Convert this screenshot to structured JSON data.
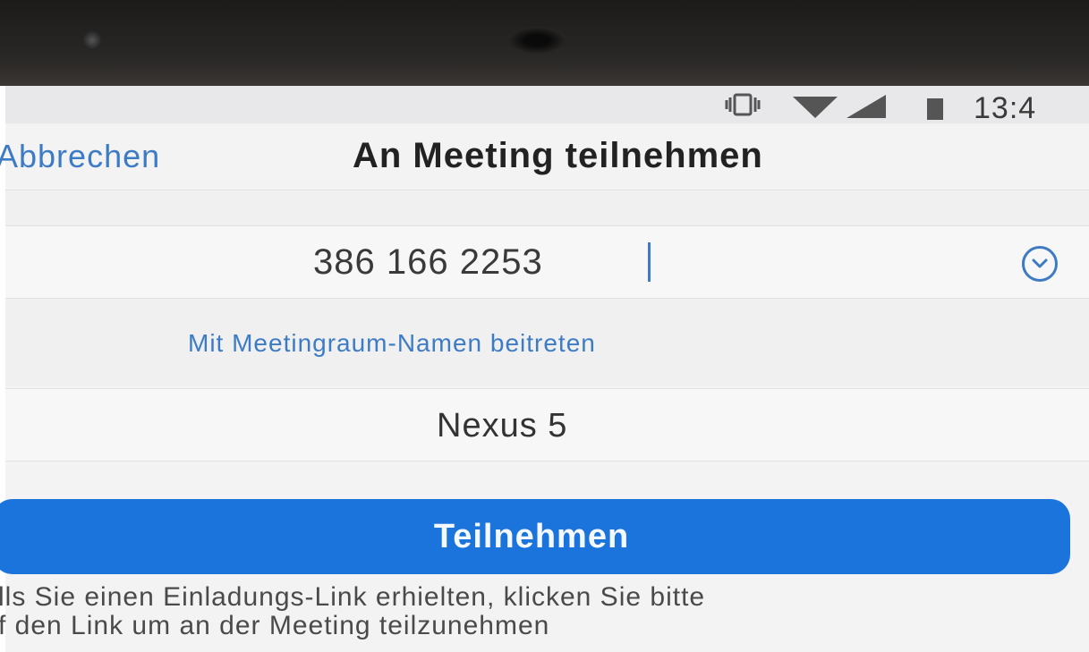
{
  "status_bar": {
    "time": "13:4",
    "icons": [
      "vibrate-icon",
      "wifi-icon",
      "signal-icon",
      "battery-icon"
    ]
  },
  "header": {
    "cancel_label": "Abbrechen",
    "title": "An Meeting teilnehmen"
  },
  "meeting_id": {
    "value": "386 166 2253",
    "dropdown_icon": "chevron-down-icon"
  },
  "room_name_link": "Mit Meetingraum-Namen beitreten",
  "display_name": "Nexus 5",
  "join_button": "Teilnehmen",
  "hint": {
    "line1": "lls Sie einen Einladungs-Link erhielten, klicken Sie bitte",
    "line2": "f den Link um an der Meeting teilzunehmen"
  },
  "colors": {
    "accent": "#3d7cc4",
    "button": "#1a74dc"
  }
}
